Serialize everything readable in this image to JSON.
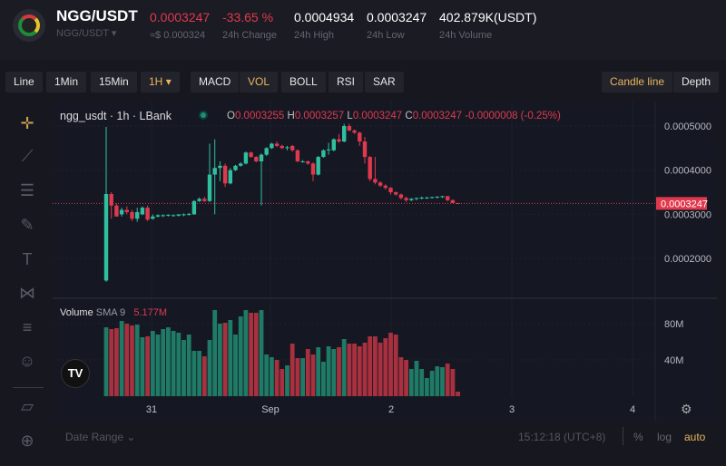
{
  "header": {
    "pair": "NGG/USDT",
    "pair_selector": "NGG/USDT",
    "last_price": "0.0003247",
    "usd_price": "≈$ 0.000324",
    "change": "-33.65 %",
    "change_label": "24h Change",
    "high": "0.0004934",
    "high_label": "24h High",
    "low": "0.0003247",
    "low_label": "24h Low",
    "volume": "402.879K(USDT)",
    "volume_label": "24h Volume"
  },
  "toolbar": {
    "items": [
      "Line",
      "1Min",
      "15Min",
      "1H",
      "MACD",
      "VOL",
      "BOLL",
      "RSI",
      "SAR"
    ],
    "active_interval": "1H",
    "active_indicator": "VOL",
    "right": [
      "Candle line",
      "Depth"
    ],
    "active_right": "Candle line"
  },
  "side_tools": [
    "crosshair-icon",
    "trend-line-icon",
    "fib-icon",
    "brush-icon",
    "text-icon",
    "pattern-icon",
    "prediction-icon",
    "emoji-icon",
    "ruler-icon",
    "zoom-in-icon"
  ],
  "legend": {
    "symbol": "ngg_usdt · 1h · LBank",
    "o_label": "O",
    "o": "0.0003255",
    "h_label": "H",
    "h": "0.0003257",
    "l_label": "L",
    "l": "0.0003247",
    "c_label": "C",
    "c": "0.0003247",
    "change": "-0.0000008 (-0.25%)"
  },
  "volume_legend": {
    "label": "Volume",
    "sma": "SMA 9",
    "value": "5.177M"
  },
  "bottom": {
    "date_range": "Date Range",
    "time": "15:12:18 (UTC+8)",
    "percent": "%",
    "log": "log",
    "auto": "auto"
  },
  "colors": {
    "up": "#2fbf9f",
    "down": "#e0394e",
    "volume_up": "#1f7a66",
    "volume_down": "#a8303f",
    "accent": "#e8b65c"
  },
  "chart_data": {
    "type": "candlestick",
    "price_ticks": [
      "0.0005000",
      "0.0004000",
      "0.0003000",
      "0.0002000"
    ],
    "price_range": [
      0.00012,
      0.00053
    ],
    "last_price_label": "0.0003247",
    "x_ticks": [
      "31",
      "Sep",
      "2",
      "3",
      "4"
    ],
    "volume_ticks": [
      "80M",
      "40M"
    ],
    "volume_unit": "M",
    "candles": [
      [
        0.00015,
        0.000498,
        0.000147,
        0.000346
      ],
      [
        0.000346,
        0.00035,
        0.00029,
        0.00032
      ],
      [
        0.00032,
        0.000325,
        0.0003,
        0.000295
      ],
      [
        0.0003,
        0.000315,
        0.000295,
        0.00031
      ],
      [
        0.00031,
        0.000318,
        0.0003,
        0.000305
      ],
      [
        0.000305,
        0.00031,
        0.000285,
        0.00029
      ],
      [
        0.00029,
        0.000315,
        0.000283,
        0.000305
      ],
      [
        0.0003,
        0.000318,
        0.000298,
        0.000315
      ],
      [
        0.000315,
        0.00032,
        0.000285,
        0.000288
      ],
      [
        0.00029,
        0.0003,
        0.000288,
        0.000295
      ],
      [
        0.000295,
        0.0003,
        0.000293,
        0.000298
      ],
      [
        0.000296,
        0.0003,
        0.000294,
        0.000298
      ],
      [
        0.000297,
        0.0003,
        0.000295,
        0.000299
      ],
      [
        0.000297,
        0.0003,
        0.000295,
        0.000298
      ],
      [
        0.000297,
        0.0003,
        0.000295,
        0.0003
      ],
      [
        0.000298,
        0.000302,
        0.000296,
        0.0003
      ],
      [
        0.0003,
        0.000303,
        0.000297,
        0.000301
      ],
      [
        0.0003,
        0.000332,
        0.000299,
        0.00033
      ],
      [
        0.00033,
        0.000338,
        0.000328,
        0.000335
      ],
      [
        0.000335,
        0.00034,
        0.000328,
        0.00033
      ],
      [
        0.00033,
        0.00046,
        0.000328,
        0.00039
      ],
      [
        0.00039,
        0.00047,
        0.0003,
        0.000405
      ],
      [
        0.000405,
        0.00042,
        0.000375,
        0.00041
      ],
      [
        0.00041,
        0.000415,
        0.000362,
        0.00037
      ],
      [
        0.00037,
        0.000405,
        0.000368,
        0.0004
      ],
      [
        0.0004,
        0.000412,
        0.000398,
        0.00041
      ],
      [
        0.00041,
        0.000418,
        0.000408,
        0.000415
      ],
      [
        0.000415,
        0.000442,
        0.000413,
        0.00044
      ],
      [
        0.00044,
        0.000442,
        0.000428,
        0.00043
      ],
      [
        0.00043,
        0.000432,
        0.000418,
        0.00042
      ],
      [
        0.00042,
        0.000438,
        0.00032,
        0.000435
      ],
      [
        0.000435,
        0.000452,
        0.000432,
        0.00045
      ],
      [
        0.00045,
        0.000462,
        0.000448,
        0.00046
      ],
      [
        0.00046,
        0.000465,
        0.000452,
        0.000455
      ],
      [
        0.000455,
        0.000458,
        0.000448,
        0.00045
      ],
      [
        0.00045,
        0.000455,
        0.000445,
        0.000452
      ],
      [
        0.000455,
        0.000457,
        0.000442,
        0.000445
      ],
      [
        0.000445,
        0.000447,
        0.000418,
        0.00042
      ],
      [
        0.00042,
        0.000423,
        0.000417,
        0.00042
      ],
      [
        0.00042,
        0.000422,
        0.000412,
        0.000415
      ],
      [
        0.000415,
        0.000418,
        0.000375,
        0.00039
      ],
      [
        0.00039,
        0.000432,
        0.000388,
        0.00043
      ],
      [
        0.00043,
        0.000447,
        0.000428,
        0.000445
      ],
      [
        0.000445,
        0.000462,
        0.000435,
        0.000447
      ],
      [
        0.000445,
        0.000472,
        0.000443,
        0.00047
      ],
      [
        0.00047,
        0.000482,
        0.000462,
        0.000465
      ],
      [
        0.000465,
        0.000505,
        0.000463,
        0.0005
      ],
      [
        0.0005,
        0.000505,
        0.000488,
        0.00049
      ],
      [
        0.00049,
        0.000492,
        0.000482,
        0.000485
      ],
      [
        0.000485,
        0.000487,
        0.000455,
        0.000465
      ],
      [
        0.000465,
        0.000475,
        0.000415,
        0.00043
      ],
      [
        0.00043,
        0.000432,
        0.000375,
        0.00038
      ],
      [
        0.00038,
        0.00043,
        0.000368,
        0.000372
      ],
      [
        0.000372,
        0.000375,
        0.000362,
        0.000365
      ],
      [
        0.000365,
        0.000368,
        0.000356,
        0.00036
      ],
      [
        0.00036,
        0.000362,
        0.000345,
        0.00035
      ],
      [
        0.00035,
        0.000352,
        0.000342,
        0.000345
      ],
      [
        0.000345,
        0.000347,
        0.000334,
        0.000337
      ],
      [
        0.000337,
        0.00034,
        0.000328,
        0.000332
      ],
      [
        0.000332,
        0.000337,
        0.00033,
        0.000335
      ],
      [
        0.000335,
        0.000338,
        0.000332,
        0.000337
      ],
      [
        0.000337,
        0.00034,
        0.000334,
        0.000338
      ],
      [
        0.000337,
        0.00034,
        0.000335,
        0.000338
      ],
      [
        0.000338,
        0.00034,
        0.000336,
        0.000339
      ],
      [
        0.000338,
        0.000341,
        0.000336,
        0.00034
      ],
      [
        0.000339,
        0.000342,
        0.000337,
        0.000341
      ],
      [
        0.000341,
        0.000342,
        0.00033,
        0.000332
      ],
      [
        0.000332,
        0.000334,
        0.000325,
        0.0003255
      ],
      [
        0.0003255,
        0.0003257,
        0.0003247,
        0.0003247
      ]
    ],
    "volume": [
      76,
      74,
      75,
      83,
      80,
      78,
      79,
      65,
      66,
      72,
      68,
      74,
      76,
      72,
      70,
      62,
      68,
      50,
      50,
      44,
      62,
      95,
      80,
      81,
      84,
      68,
      88,
      95,
      92,
      92,
      95,
      46,
      43,
      40,
      30,
      34,
      58,
      42,
      42,
      52,
      46,
      54,
      38,
      55,
      52,
      54,
      63,
      58,
      58,
      55,
      59,
      66,
      66,
      59,
      64,
      70,
      68,
      43,
      40,
      30,
      39,
      30,
      20,
      28,
      33,
      32,
      36,
      30,
      5
    ]
  }
}
